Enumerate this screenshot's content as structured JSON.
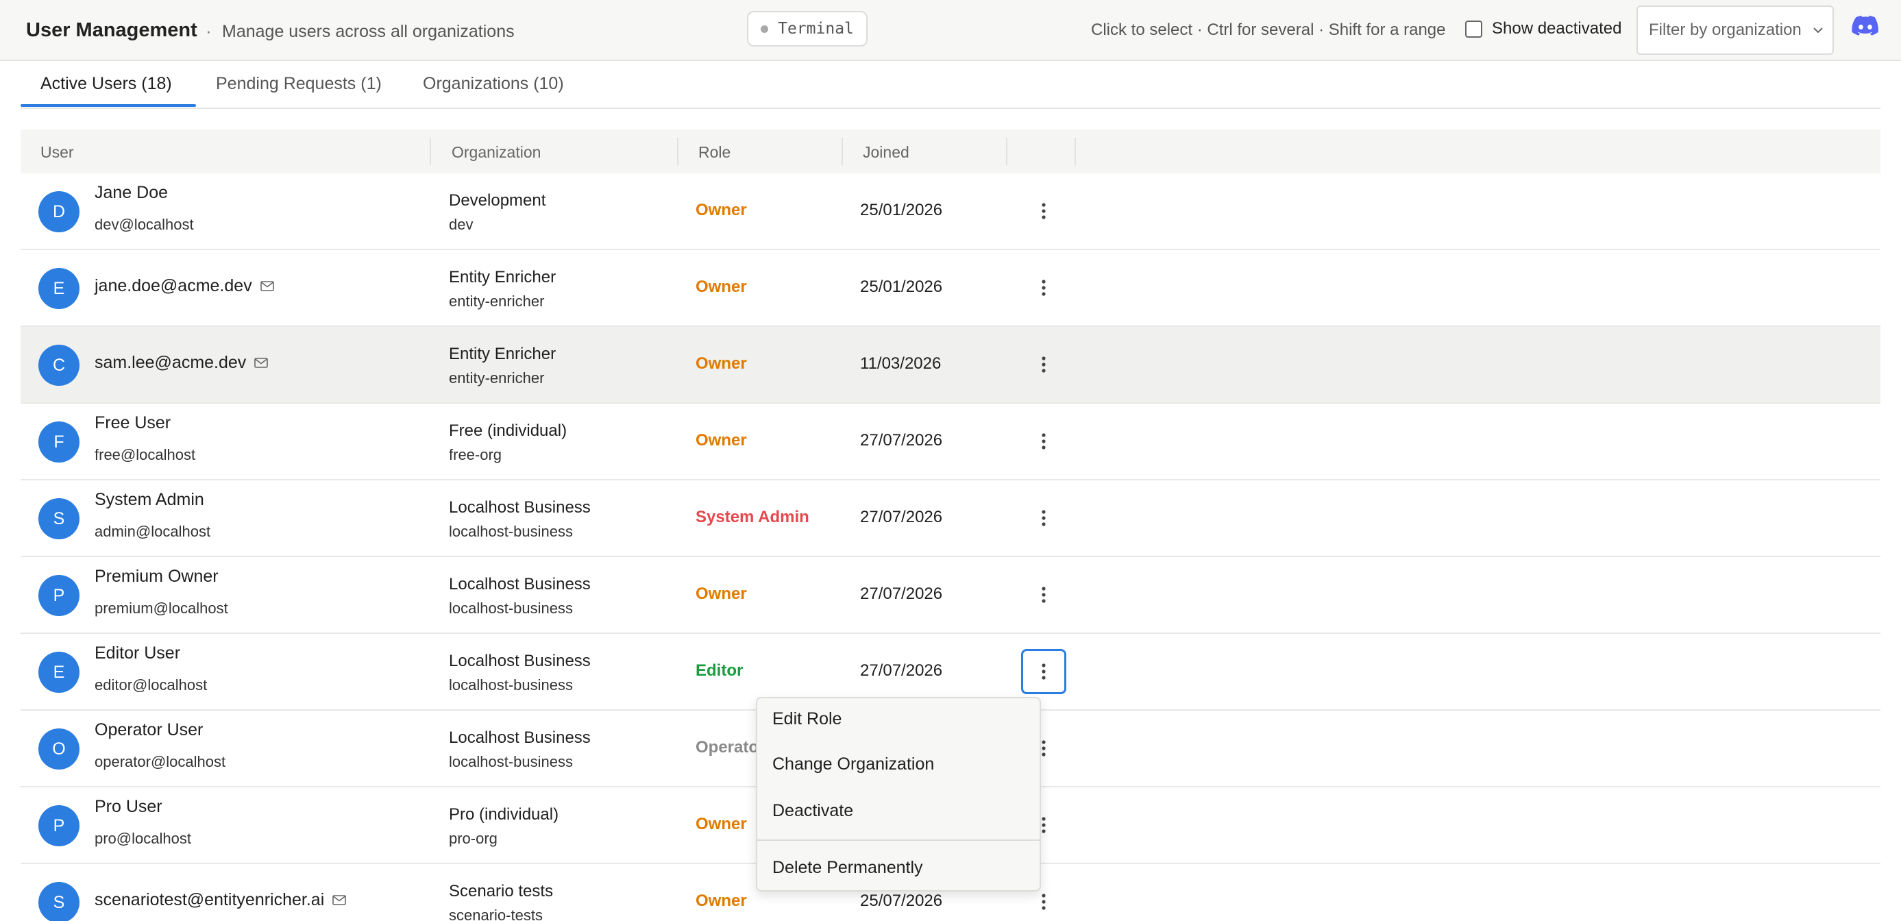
{
  "header": {
    "title": "User Management",
    "separator": "·",
    "subtitle": "Manage users across all organizations",
    "terminal_label": "Terminal",
    "selection_hint": "Click to select · Ctrl for several · Shift for a range",
    "show_deactivated_label": "Show deactivated",
    "show_deactivated_checked": false,
    "org_filter_placeholder": "Filter by organization"
  },
  "tabs": [
    {
      "label": "Active Users (18)",
      "active": true
    },
    {
      "label": "Pending Requests (1)",
      "active": false
    },
    {
      "label": "Organizations (10)",
      "active": false
    }
  ],
  "table": {
    "columns": [
      "User",
      "Organization",
      "Role",
      "Joined"
    ],
    "rows": [
      {
        "initial": "D",
        "name": "Jane Doe",
        "email": "dev@localhost",
        "org": "Development",
        "slug": "dev",
        "role": "Owner",
        "joined": "25/01/2026"
      },
      {
        "initial": "E",
        "name": "",
        "email": "jane.doe@acme.dev",
        "org": "Entity Enricher",
        "slug": "entity-enricher",
        "role": "Owner",
        "joined": "25/01/2026"
      },
      {
        "initial": "C",
        "name": "",
        "email": "sam.lee@acme.dev",
        "org": "Entity Enricher",
        "slug": "entity-enricher",
        "role": "Owner",
        "joined": "11/03/2026"
      },
      {
        "initial": "F",
        "name": "Free User",
        "email": "free@localhost",
        "org": "Free (individual)",
        "slug": "free-org",
        "role": "Owner",
        "joined": "27/07/2026"
      },
      {
        "initial": "S",
        "name": "System Admin",
        "email": "admin@localhost",
        "org": "Localhost Business",
        "slug": "localhost-business",
        "role": "System Admin",
        "joined": "27/07/2026"
      },
      {
        "initial": "P",
        "name": "Premium Owner",
        "email": "premium@localhost",
        "org": "Localhost Business",
        "slug": "localhost-business",
        "role": "Owner",
        "joined": "27/07/2026"
      },
      {
        "initial": "E",
        "name": "Editor User",
        "email": "editor@localhost",
        "org": "Localhost Business",
        "slug": "localhost-business",
        "role": "Editor",
        "joined": "27/07/2026"
      },
      {
        "initial": "O",
        "name": "Operator User",
        "email": "operator@localhost",
        "org": "Localhost Business",
        "slug": "localhost-business",
        "role": "Operator",
        "joined": ""
      },
      {
        "initial": "P",
        "name": "Pro User",
        "email": "pro@localhost",
        "org": "Pro (individual)",
        "slug": "pro-org",
        "role": "Owner",
        "joined": ""
      },
      {
        "initial": "S",
        "name": "",
        "email": "scenariotest@entityenricher.ai",
        "org": "Scenario tests",
        "slug": "scenario-tests",
        "role": "Owner",
        "joined": "25/07/2026"
      }
    ]
  },
  "context_menu": {
    "items": [
      "Edit Role",
      "Change Organization",
      "Deactivate",
      "Delete Permanently"
    ]
  },
  "colors": {
    "accent": "#2b7de0",
    "owner": "#e07b00",
    "system_admin": "#e5484d",
    "editor": "#1a9c3e",
    "operator": "#8a8a8a"
  },
  "icons": {
    "discord": "discord-icon",
    "mail": "mail-icon",
    "kebab": "more-vertical-icon",
    "chevron": "chevron-down-icon"
  }
}
